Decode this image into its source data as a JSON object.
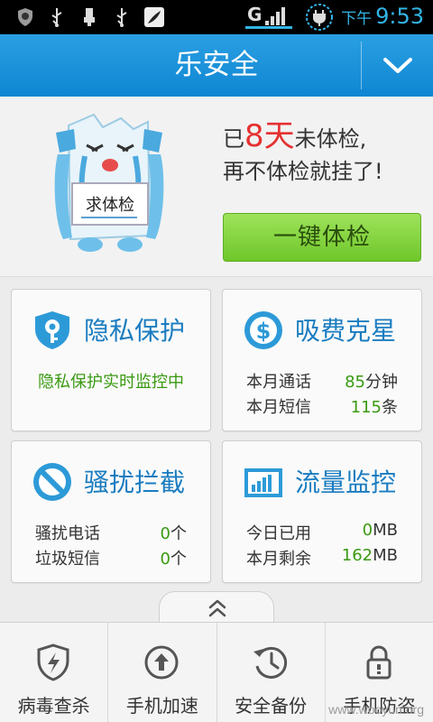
{
  "status_bar": {
    "network_label": "G",
    "time_period": "下午",
    "time": "9:53",
    "notification_icons": [
      "security-app-icon",
      "usb-icon",
      "usb-debug-icon",
      "usb-icon",
      "pea-pod-icon"
    ],
    "accent_color": "#33b5e5"
  },
  "header": {
    "title": "乐安全",
    "menu_icon": "chevron-down-icon",
    "color": "#1a92dc"
  },
  "hero": {
    "mascot_sign": "求体检",
    "line1_prefix": "已",
    "days_count": "8天",
    "line1_suffix": "未体检,",
    "line2": "再不体检就挂了!",
    "check_button": "一键体检"
  },
  "cards": {
    "privacy": {
      "title": "隐私保护",
      "status": "隐私保护实时监控中",
      "icon": "privacy-lock-icon"
    },
    "fees": {
      "title": "吸费克星",
      "icon": "dollar-icon",
      "calls_label": "本月通话",
      "calls_value": "85",
      "calls_unit": "分钟",
      "sms_label": "本月短信",
      "sms_value": "115",
      "sms_unit": "条"
    },
    "harass": {
      "title": "骚扰拦截",
      "icon": "block-icon",
      "calls_label": "骚扰电话",
      "calls_value": "0",
      "calls_unit": "个",
      "sms_label": "垃圾短信",
      "sms_value": "0",
      "sms_unit": "个"
    },
    "traffic": {
      "title": "流量监控",
      "icon": "bar-chart-icon",
      "used_label": "今日已用",
      "used_value": "0",
      "used_unit": "MB",
      "left_label": "本月剩余",
      "left_value": "162",
      "left_unit": "MB"
    }
  },
  "bottom_nav": [
    {
      "label": "病毒查杀",
      "icon": "antivirus-shield-icon"
    },
    {
      "label": "手机加速",
      "icon": "speed-up-icon"
    },
    {
      "label": "安全备份",
      "icon": "backup-history-icon"
    },
    {
      "label": "手机防盗",
      "icon": "anti-theft-lock-icon"
    }
  ],
  "watermark": "www.wooyun.org"
}
